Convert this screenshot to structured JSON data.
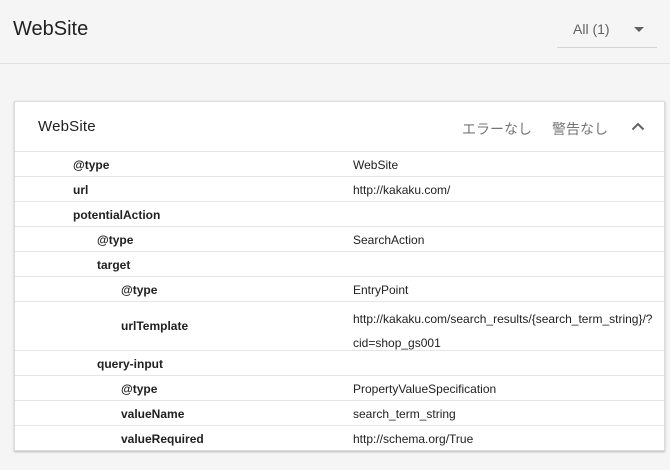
{
  "header": {
    "title": "WebSite",
    "filter_label": "All (1)"
  },
  "card": {
    "title": "WebSite",
    "errors_label": "エラーなし",
    "warnings_label": "警告なし"
  },
  "rows": [
    {
      "key": "@type",
      "value": "WebSite",
      "level": 0
    },
    {
      "key": "url",
      "value": "http://kakaku.com/",
      "level": 0
    },
    {
      "key": "potentialAction",
      "value": "",
      "level": 0
    },
    {
      "key": "@type",
      "value": "SearchAction",
      "level": 1
    },
    {
      "key": "target",
      "value": "",
      "level": 1
    },
    {
      "key": "@type",
      "value": "EntryPoint",
      "level": 2
    },
    {
      "key": "urlTemplate",
      "value": "http://kakaku.com/search_results/{search_term_string}/?cid=shop_gs001",
      "level": 2
    },
    {
      "key": "query-input",
      "value": "",
      "level": 1
    },
    {
      "key": "@type",
      "value": "PropertyValueSpecification",
      "level": 2
    },
    {
      "key": "valueName",
      "value": "search_term_string",
      "level": 2
    },
    {
      "key": "valueRequired",
      "value": "http://schema.org/True",
      "level": 2
    }
  ],
  "icons": {
    "filter": "chevron-down-icon",
    "collapse": "chevron-up-icon"
  },
  "colors": {
    "background": "#f5f5f5",
    "card": "#ffffff",
    "text": "#212121",
    "muted": "#757575"
  }
}
